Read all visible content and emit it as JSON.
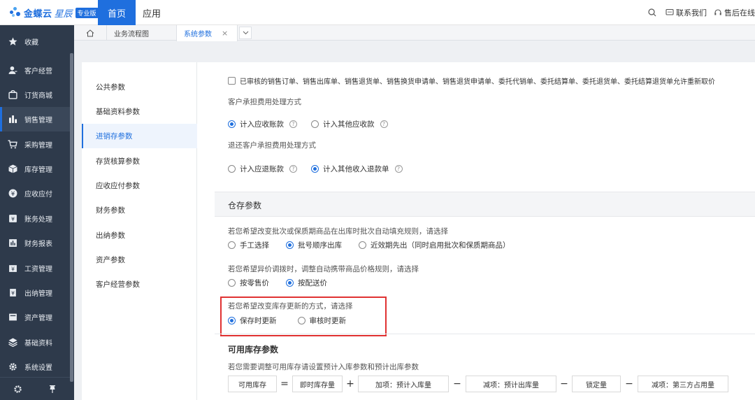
{
  "topbar": {
    "brand": "金蝶云",
    "brand_sub": "星辰",
    "brand_badge": "专业版",
    "nav_home": "首页",
    "nav_apps": "应用",
    "contact": "联系我们",
    "support": "售后在线"
  },
  "sidebar": {
    "items": [
      {
        "label": "收藏",
        "icon": "star-icon"
      },
      {
        "label": "客户经营",
        "icon": "user-icon"
      },
      {
        "label": "订货商城",
        "icon": "shop-icon"
      },
      {
        "label": "销售管理",
        "icon": "bar-chart-icon"
      },
      {
        "label": "采购管理",
        "icon": "cart-icon"
      },
      {
        "label": "库存管理",
        "icon": "box-icon"
      },
      {
        "label": "应收应付",
        "icon": "yen-circle-icon"
      },
      {
        "label": "账务处理",
        "icon": "ledger-icon"
      },
      {
        "label": "财务报表",
        "icon": "report-icon"
      },
      {
        "label": "工资管理",
        "icon": "salary-icon"
      },
      {
        "label": "出纳管理",
        "icon": "cashier-icon"
      },
      {
        "label": "资产管理",
        "icon": "asset-icon"
      },
      {
        "label": "基础资料",
        "icon": "layers-icon"
      },
      {
        "label": "系统设置",
        "icon": "gear-icon"
      }
    ],
    "active_index": 3
  },
  "tabs": {
    "flow": "业务流程图",
    "sys": "系统参数",
    "close": "×"
  },
  "leftnav": {
    "items": [
      "公共参数",
      "基础资料参数",
      "进销存参数",
      "存货核算参数",
      "应收应付参数",
      "财务参数",
      "出纳参数",
      "资产参数",
      "客户经营参数"
    ],
    "active_index": 2
  },
  "main": {
    "recalc_checkbox": "已审核的销售订单、销售出库单、销售退货单、销售换货申请单、销售退货申请单、委托代销单、委托结算单、委托退货单、委托结算退货单允许重新取价",
    "cust_fee_title": "客户承担费用处理方式",
    "cust_fee_opt1": "计入应收账款",
    "cust_fee_opt2": "计入其他应收款",
    "refund_title": "退还客户承担费用处理方式",
    "refund_opt1": "计入应退账款",
    "refund_opt2": "计入其他收入退款单",
    "help": "?",
    "warehouse_section": "仓存参数",
    "batch_title": "若您希望改变批次或保质期商品在出库时批次自动填充规则，请选择",
    "batch_opt1": "手工选择",
    "batch_opt2": "批号顺序出库",
    "batch_opt3": "近效期先出（同时启用批次和保质期商品）",
    "price_title": "若您希望异价调拨时，调整自动携带商品价格规则，请选择",
    "price_opt1": "按零售价",
    "price_opt2": "按配送价",
    "update_title": "若您希望改变库存更新的方式，请选择",
    "update_opt1": "保存时更新",
    "update_opt2": "审核时更新",
    "avail_heading": "可用库存参数",
    "avail_desc": "若您需要调整可用库存请设置预计入库参数和预计出库参数",
    "formula": {
      "avail": "可用库存",
      "eq": "=",
      "instant": "即时库存量",
      "plus": "+",
      "add_in": "加项：预计入库量",
      "minus": "−",
      "sub_out": "减项：预计出库量",
      "locked": "锁定量",
      "sub_third": "减项：第三方占用量"
    }
  }
}
